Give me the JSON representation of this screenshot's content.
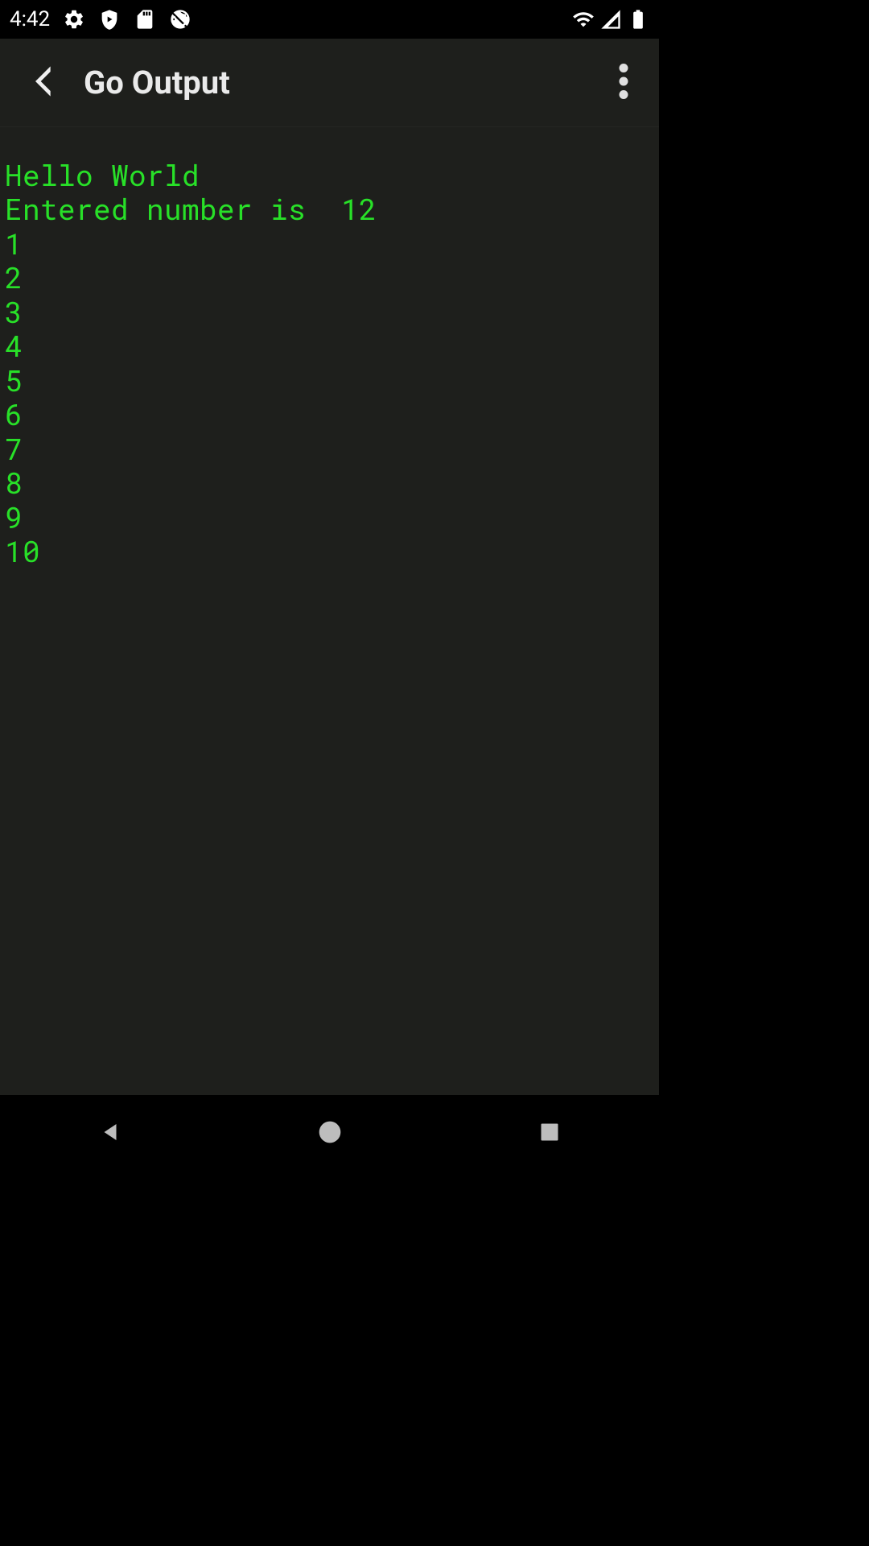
{
  "status_bar": {
    "time": "4:42"
  },
  "app_bar": {
    "title": "Go Output"
  },
  "output": {
    "lines": [
      "Hello World",
      "Entered number is  12",
      "1",
      "2",
      "3",
      "4",
      "5",
      "6",
      "7",
      "8",
      "9",
      "10"
    ]
  },
  "colors": {
    "terminal_text": "#28e028",
    "background": "#1e1f1c",
    "status_bg": "#000000"
  }
}
